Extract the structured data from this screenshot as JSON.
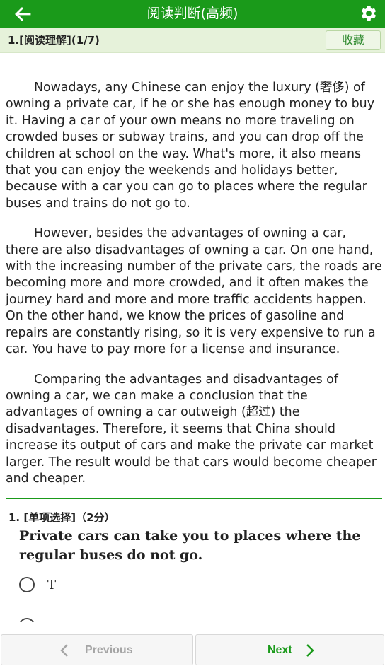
{
  "header": {
    "title": "阅读判断(高频)",
    "back_icon": "arrow-left-icon",
    "settings_icon": "gear-icon",
    "bg_color": "#1a9a1a"
  },
  "subheader": {
    "question_title": "1.[阅读理解](1/7)",
    "favorite_label": "收藏"
  },
  "passage": {
    "paragraphs": [
      "Nowadays, any Chinese can enjoy the luxury (奢侈) of owning a private car, if he or she has enough money to buy it. Having a car of your own means no more traveling on crowded buses or subway trains, and you can drop off the children at school on the way. What's more, it also means that you can enjoy the weekends and holidays better, because with a car you can go to places where the regular buses and trains do not go to.",
      "However, besides the advantages of owning a car, there are also disadvantages of owning a car. On one hand, with the increasing number of the private cars, the roads are becoming more and more crowded, and it often makes the journey hard and more and more traffic accidents happen. On the other hand, we know the prices of gasoline and repairs are constantly rising, so it is very expensive to run a car. You have to pay more for a license and insurance.",
      "Comparing the advantages and disadvantages of owning a car, we can make a conclusion that the advantages of owning a car outweigh (超过) the disadvantages. Therefore, it seems that China should increase its output of cars and make the private car market larger. The result would be that cars would become cheaper and cheaper."
    ]
  },
  "question": {
    "label": "1. [单项选择]（2分）",
    "text": "Private cars can take you to places where the regular buses do not go.",
    "options": [
      {
        "label": "T"
      }
    ]
  },
  "footer": {
    "previous_label": "Previous",
    "next_label": "Next",
    "previous_icon": "chevron-left-icon",
    "next_icon": "chevron-right-icon"
  }
}
